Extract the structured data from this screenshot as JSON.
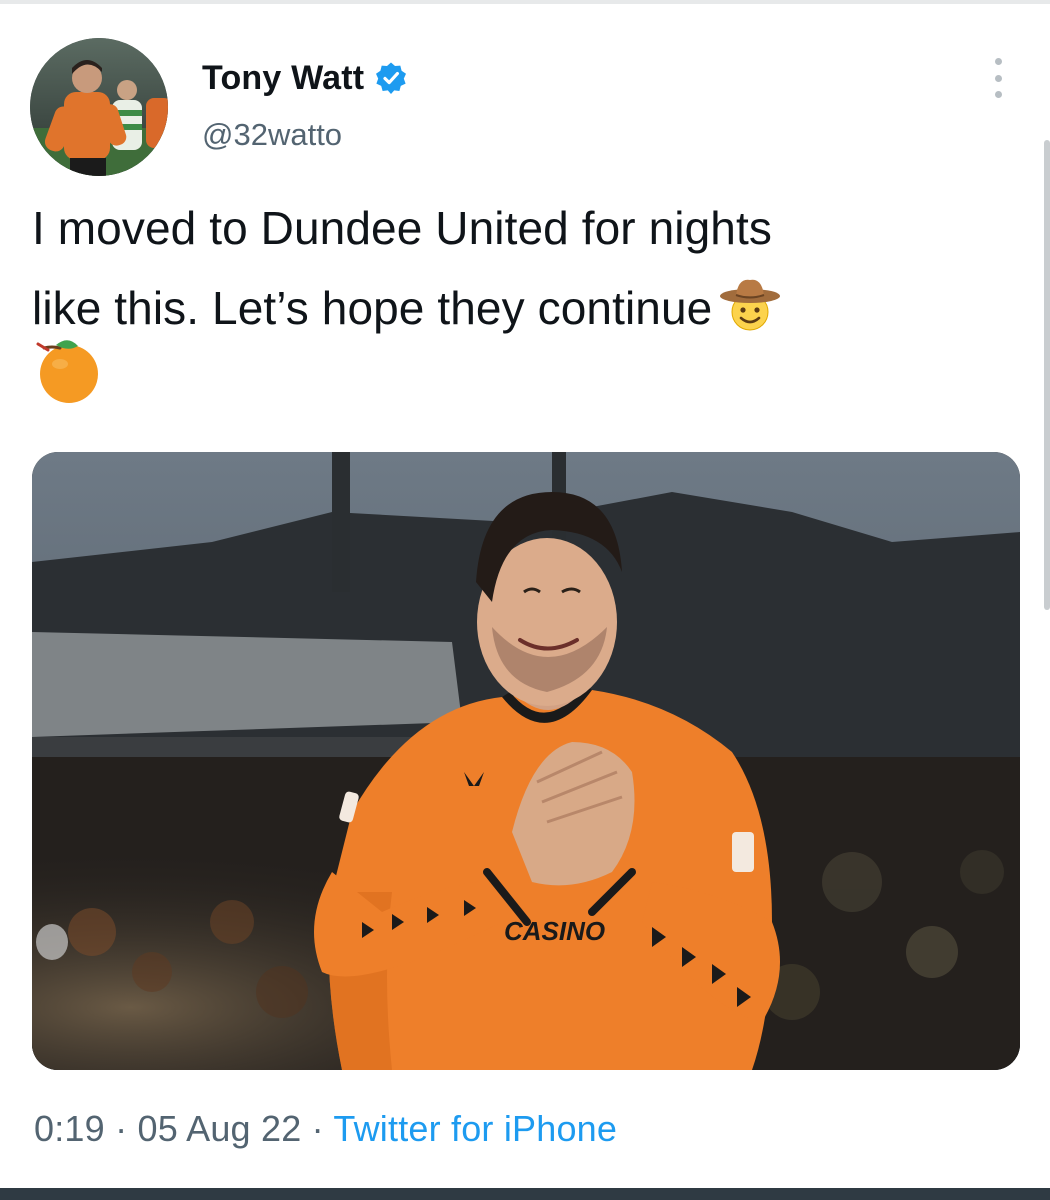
{
  "author": {
    "display_name": "Tony Watt",
    "handle": "@32watto",
    "verified": true
  },
  "tweet": {
    "text_line1": "I moved to Dundee United for nights",
    "text_line2": "like this. Let’s hope they continue",
    "emojis": [
      "cowboy-face",
      "tangerine"
    ]
  },
  "media": {
    "jersey_text": "CASINO",
    "jersey_color": "#ee7f2a"
  },
  "meta": {
    "time": "0:19",
    "sep1": " · ",
    "date": "05 Aug 22",
    "sep2": " · ",
    "source": "Twitter for iPhone"
  },
  "colors": {
    "verified": "#1d9bf0",
    "text": "#0f1419",
    "secondary": "#536471",
    "link": "#1d9bf0"
  }
}
